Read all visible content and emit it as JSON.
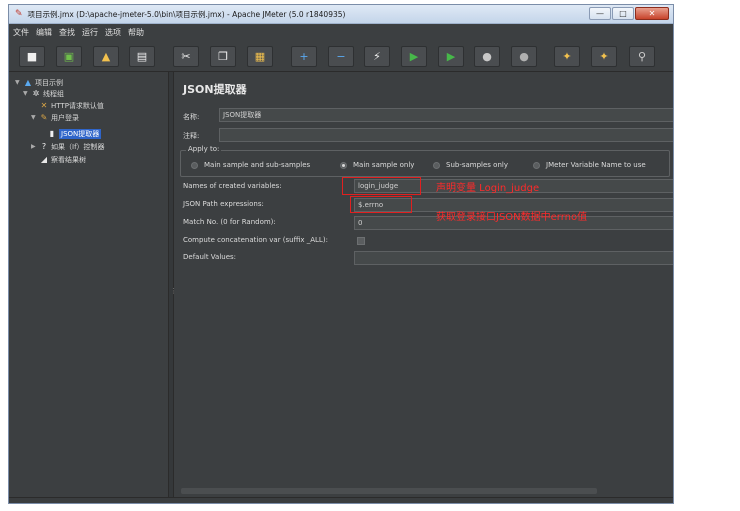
{
  "window": {
    "title": "项目示例.jmx (D:\\apache-jmeter-5.0\\bin\\项目示例.jmx) - Apache JMeter (5.0 r1840935)",
    "app_icon": "jmeter-feather-icon",
    "controls": {
      "minimize": "—",
      "maximize": "□",
      "close": "✕"
    }
  },
  "menubar": [
    "文件",
    "编辑",
    "查找",
    "运行",
    "选项",
    "帮助"
  ],
  "toolbar": [
    {
      "name": "new-icon",
      "glyph": "■",
      "color": "#f0f0f0"
    },
    {
      "name": "templates-icon",
      "glyph": "▣",
      "color": "#6fbf4a"
    },
    {
      "name": "open-icon",
      "glyph": "▲",
      "color": "#f2c14e"
    },
    {
      "name": "save-icon",
      "glyph": "▤",
      "color": "#f0f0f0"
    },
    {
      "name": "cut-icon",
      "glyph": "✂",
      "color": "#f0f0f0"
    },
    {
      "name": "copy-icon",
      "glyph": "❐",
      "color": "#f0f0f0"
    },
    {
      "name": "paste-icon",
      "glyph": "▦",
      "color": "#f2c14e"
    },
    {
      "name": "expand-icon",
      "glyph": "+",
      "color": "#5aa9f0"
    },
    {
      "name": "collapse-icon",
      "glyph": "−",
      "color": "#5aa9f0"
    },
    {
      "name": "toggle-icon",
      "glyph": "⚡",
      "color": "#f0f0f0"
    },
    {
      "name": "start-icon",
      "glyph": "▶",
      "color": "#47b84a"
    },
    {
      "name": "start-no-pauses-icon",
      "glyph": "▶",
      "color": "#47b84a"
    },
    {
      "name": "stop-icon",
      "glyph": "●",
      "color": "#c8c8c8"
    },
    {
      "name": "shutdown-icon",
      "glyph": "●",
      "color": "#b0b0b0"
    },
    {
      "name": "clear-icon",
      "glyph": "✦",
      "color": "#f2c14e"
    },
    {
      "name": "clear-all-icon",
      "glyph": "✦",
      "color": "#f2c14e"
    },
    {
      "name": "search-icon",
      "glyph": "⚲",
      "color": "#d0d0d0"
    }
  ],
  "tree": [
    {
      "label": "项目示例",
      "icon": "test-plan-icon",
      "glyph": "▲",
      "color": "#5aa9f0",
      "indent": 0,
      "arrow": "▼"
    },
    {
      "label": "线程组",
      "icon": "thread-group-icon",
      "glyph": "✲",
      "color": "#e8e8e8",
      "indent": 1,
      "arrow": "▼"
    },
    {
      "label": "HTTP请求默认值",
      "icon": "config-element-icon",
      "glyph": "✕",
      "color": "#d9a546",
      "indent": 2,
      "arrow": ""
    },
    {
      "label": "用户登录",
      "icon": "sampler-icon",
      "glyph": "✎",
      "color": "#d9a546",
      "indent": 2,
      "arrow": "▼"
    },
    {
      "label": "JSON提取器",
      "icon": "extractor-icon",
      "glyph": "▮",
      "color": "#f0f0f0",
      "indent": 3,
      "arrow": "",
      "selected": true
    },
    {
      "label": "如果（If）控制器",
      "icon": "if-controller-icon",
      "glyph": "?",
      "color": "#f0f0f0",
      "indent": 2,
      "arrow": "▶"
    },
    {
      "label": "察看结果树",
      "icon": "listener-icon",
      "glyph": "◢",
      "color": "#e8e8e8",
      "indent": 2,
      "arrow": ""
    }
  ],
  "panel": {
    "title": "JSON提取器",
    "name_label": "名称:",
    "name_value": "JSON提取器",
    "comments_label": "注释:",
    "comments_value": "",
    "apply_to": {
      "legend": "Apply to:",
      "options": [
        "Main sample and sub-samples",
        "Main sample only",
        "Sub-samples only",
        "JMeter Variable Name to use"
      ],
      "selected": "Main sample only"
    },
    "fields": {
      "var_names_label": "Names of created variables:",
      "var_names_value": "login_judge",
      "json_path_label": "JSON Path expressions:",
      "json_path_value": "$.errno",
      "match_no_label": "Match No. (0 for Random):",
      "match_no_value": "0",
      "concat_label": "Compute concatenation var (suffix _ALL):",
      "default_label": "Default Values:",
      "default_value": ""
    }
  },
  "annotations": {
    "note1": "声明变量 Login_judge",
    "note2": "获取登录接口JSON数据中errno值",
    "color": "#ff2a2a"
  }
}
